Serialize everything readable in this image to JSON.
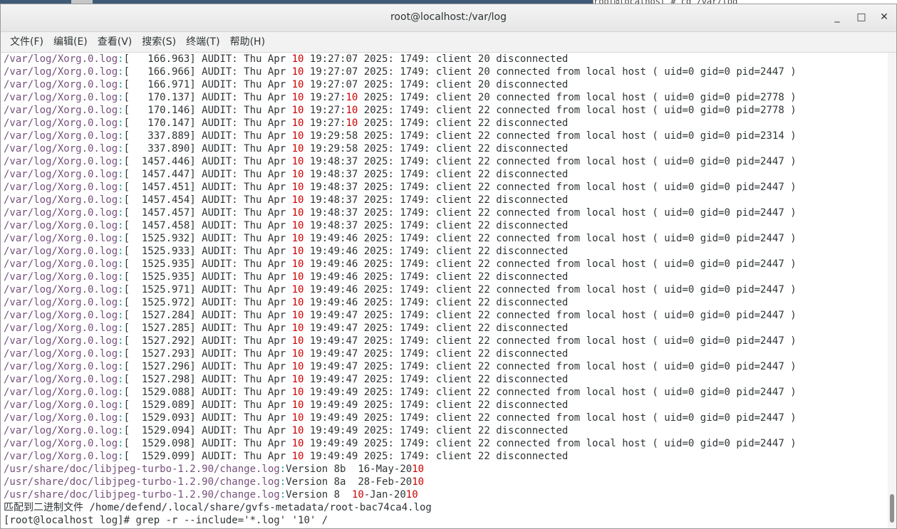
{
  "background_window": {
    "text": "root@localhost  # cd /var/log"
  },
  "window": {
    "title": "root@localhost:/var/log"
  },
  "window_buttons": {
    "minimize": "_",
    "maximize": "□",
    "close": "✕"
  },
  "menu": [
    "文件(F)",
    "编辑(E)",
    "查看(V)",
    "搜索(S)",
    "终端(T)",
    "帮助(H)"
  ],
  "terminal": {
    "xorg_prefix": "/var/log/Xorg.0.log",
    "audit_lines": [
      {
        "ts": "   166.963",
        "time": "19:27:07",
        "msg": "client 20 disconnected"
      },
      {
        "ts": "   166.966",
        "time": "19:27:07",
        "msg": "client 20 connected from local host ( uid=0 gid=0 pid=2447 )"
      },
      {
        "ts": "   166.971",
        "time": "19:27:07",
        "msg": "client 20 disconnected"
      },
      {
        "ts": "   170.137",
        "time": "19:27:10",
        "msg": "client 20 connected from local host ( uid=0 gid=0 pid=2778 )"
      },
      {
        "ts": "   170.146",
        "time": "19:27:10",
        "msg": "client 22 connected from local host ( uid=0 gid=0 pid=2778 )"
      },
      {
        "ts": "   170.147",
        "time": "19:27:10",
        "msg": "client 22 disconnected"
      },
      {
        "ts": "   337.889",
        "time": "19:29:58",
        "msg": "client 22 connected from local host ( uid=0 gid=0 pid=2314 )"
      },
      {
        "ts": "   337.890",
        "time": "19:29:58",
        "msg": "client 22 disconnected"
      },
      {
        "ts": "  1457.446",
        "time": "19:48:37",
        "msg": "client 22 connected from local host ( uid=0 gid=0 pid=2447 )"
      },
      {
        "ts": "  1457.447",
        "time": "19:48:37",
        "msg": "client 22 disconnected"
      },
      {
        "ts": "  1457.451",
        "time": "19:48:37",
        "msg": "client 22 connected from local host ( uid=0 gid=0 pid=2447 )"
      },
      {
        "ts": "  1457.454",
        "time": "19:48:37",
        "msg": "client 22 disconnected"
      },
      {
        "ts": "  1457.457",
        "time": "19:48:37",
        "msg": "client 22 connected from local host ( uid=0 gid=0 pid=2447 )"
      },
      {
        "ts": "  1457.458",
        "time": "19:48:37",
        "msg": "client 22 disconnected"
      },
      {
        "ts": "  1525.932",
        "time": "19:49:46",
        "msg": "client 22 connected from local host ( uid=0 gid=0 pid=2447 )"
      },
      {
        "ts": "  1525.933",
        "time": "19:49:46",
        "msg": "client 22 disconnected"
      },
      {
        "ts": "  1525.935",
        "time": "19:49:46",
        "msg": "client 22 connected from local host ( uid=0 gid=0 pid=2447 )"
      },
      {
        "ts": "  1525.935",
        "time": "19:49:46",
        "msg": "client 22 disconnected"
      },
      {
        "ts": "  1525.971",
        "time": "19:49:46",
        "msg": "client 22 connected from local host ( uid=0 gid=0 pid=2447 )"
      },
      {
        "ts": "  1525.972",
        "time": "19:49:46",
        "msg": "client 22 disconnected"
      },
      {
        "ts": "  1527.284",
        "time": "19:49:47",
        "msg": "client 22 connected from local host ( uid=0 gid=0 pid=2447 )"
      },
      {
        "ts": "  1527.285",
        "time": "19:49:47",
        "msg": "client 22 disconnected"
      },
      {
        "ts": "  1527.292",
        "time": "19:49:47",
        "msg": "client 22 connected from local host ( uid=0 gid=0 pid=2447 )"
      },
      {
        "ts": "  1527.293",
        "time": "19:49:47",
        "msg": "client 22 disconnected"
      },
      {
        "ts": "  1527.296",
        "time": "19:49:47",
        "msg": "client 22 connected from local host ( uid=0 gid=0 pid=2447 )"
      },
      {
        "ts": "  1527.298",
        "time": "19:49:47",
        "msg": "client 22 disconnected"
      },
      {
        "ts": "  1529.088",
        "time": "19:49:49",
        "msg": "client 22 connected from local host ( uid=0 gid=0 pid=2447 )"
      },
      {
        "ts": "  1529.089",
        "time": "19:49:49",
        "msg": "client 22 disconnected"
      },
      {
        "ts": "  1529.093",
        "time": "19:49:49",
        "msg": "client 22 connected from local host ( uid=0 gid=0 pid=2447 )"
      },
      {
        "ts": "  1529.094",
        "time": "19:49:49",
        "msg": "client 22 disconnected"
      },
      {
        "ts": "  1529.098",
        "time": "19:49:49",
        "msg": "client 22 connected from local host ( uid=0 gid=0 pid=2447 )"
      },
      {
        "ts": "  1529.099",
        "time": "19:49:49",
        "msg": "client 22 disconnected"
      }
    ],
    "changelog_prefix": "/usr/share/doc/libjpeg-turbo-1.2.90/change.log",
    "changelog_lines": [
      "Version 8b  16-May-2010",
      "Version 8a  28-Feb-2010",
      "Version 8  10-Jan-2010"
    ],
    "binary_match": "匹配到二进制文件 /home/defend/.local/share/gvfs-metadata/root-bac74ca4.log",
    "prompt": "[root@localhost log]# ",
    "command": "grep -r --include='*.log' '10' /"
  }
}
